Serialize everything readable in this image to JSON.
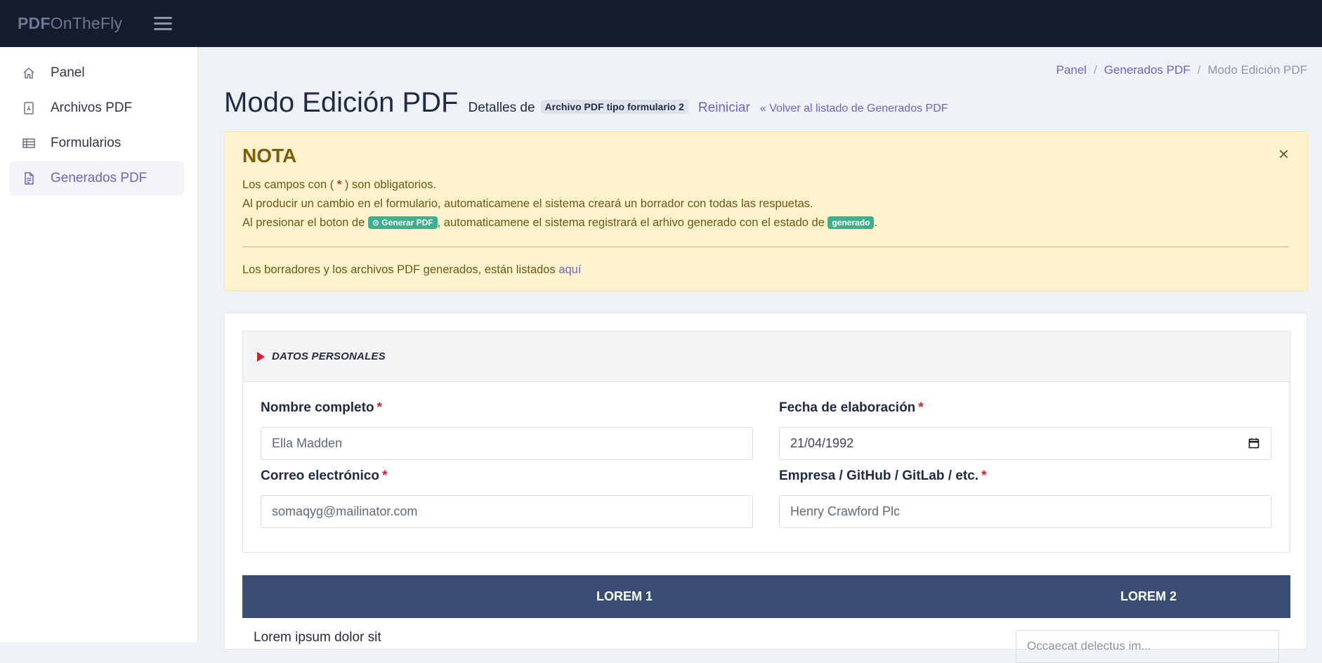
{
  "brand": {
    "bold": "PDF",
    "rest": "OnTheFly"
  },
  "sidebar": {
    "items": [
      {
        "label": "Panel",
        "icon": "home-icon"
      },
      {
        "label": "Archivos PDF",
        "icon": "pdf-file-icon"
      },
      {
        "label": "Formularios",
        "icon": "table-icon"
      },
      {
        "label": "Generados PDF",
        "icon": "document-icon",
        "active": true
      }
    ]
  },
  "breadcrumb": {
    "items": [
      "Panel",
      "Generados PDF"
    ],
    "current": "Modo Edición PDF",
    "separator": "/"
  },
  "header": {
    "title": "Modo Edición PDF",
    "subtitle": "Detalles de",
    "chip": "Archivo PDF tipo formulario 2",
    "reset": "Reiniciar",
    "back_icon": "«",
    "back": "Volver al listado de Generados PDF"
  },
  "note": {
    "title": "NOTA",
    "close": "×",
    "line1_a": "Los campos con (",
    "line1_req": "*",
    "line1_b": ") son obligatorios.",
    "line2": "Al producir un cambio en el formulario, automaticamene el sistema creará un borrador con todas las respuetas.",
    "line3_a": "Al presionar el boton de",
    "line3_badge": "Generar PDF",
    "line3_b": ", automaticamene el sistema registrará el arhivo generado con el estado de",
    "line3_badge2": "generado",
    "line3_c": ".",
    "line4": "Los borradores y los archivos PDF generados, están listados",
    "line4_link": "aquí"
  },
  "section": {
    "title": "DATOS PERSONALES",
    "fields": {
      "nombre": {
        "label": "Nombre completo",
        "value": "Ella Madden"
      },
      "fecha": {
        "label": "Fecha de elaboración",
        "value": "21/04/1992"
      },
      "correo": {
        "label": "Correo electrónico",
        "value": "somaqyg@mailinator.com"
      },
      "empresa": {
        "label": "Empresa / GitHub / GitLab / etc.",
        "value": "Henry Crawford Plc"
      }
    },
    "required_mark": "*"
  },
  "table": {
    "columns": [
      "LOREM 1",
      "LOREM 2"
    ],
    "rows": [
      {
        "text": "Lorem ipsum dolor sit",
        "placeholder": "Occaecat delectus im..."
      }
    ]
  },
  "colors": {
    "topbar": "#161b2e",
    "accent": "#6f63c5",
    "alert_bg": "#fff3cd",
    "table_head": "#3a4d73",
    "badge_green": "#3fae8c",
    "required": "#d4202e"
  }
}
